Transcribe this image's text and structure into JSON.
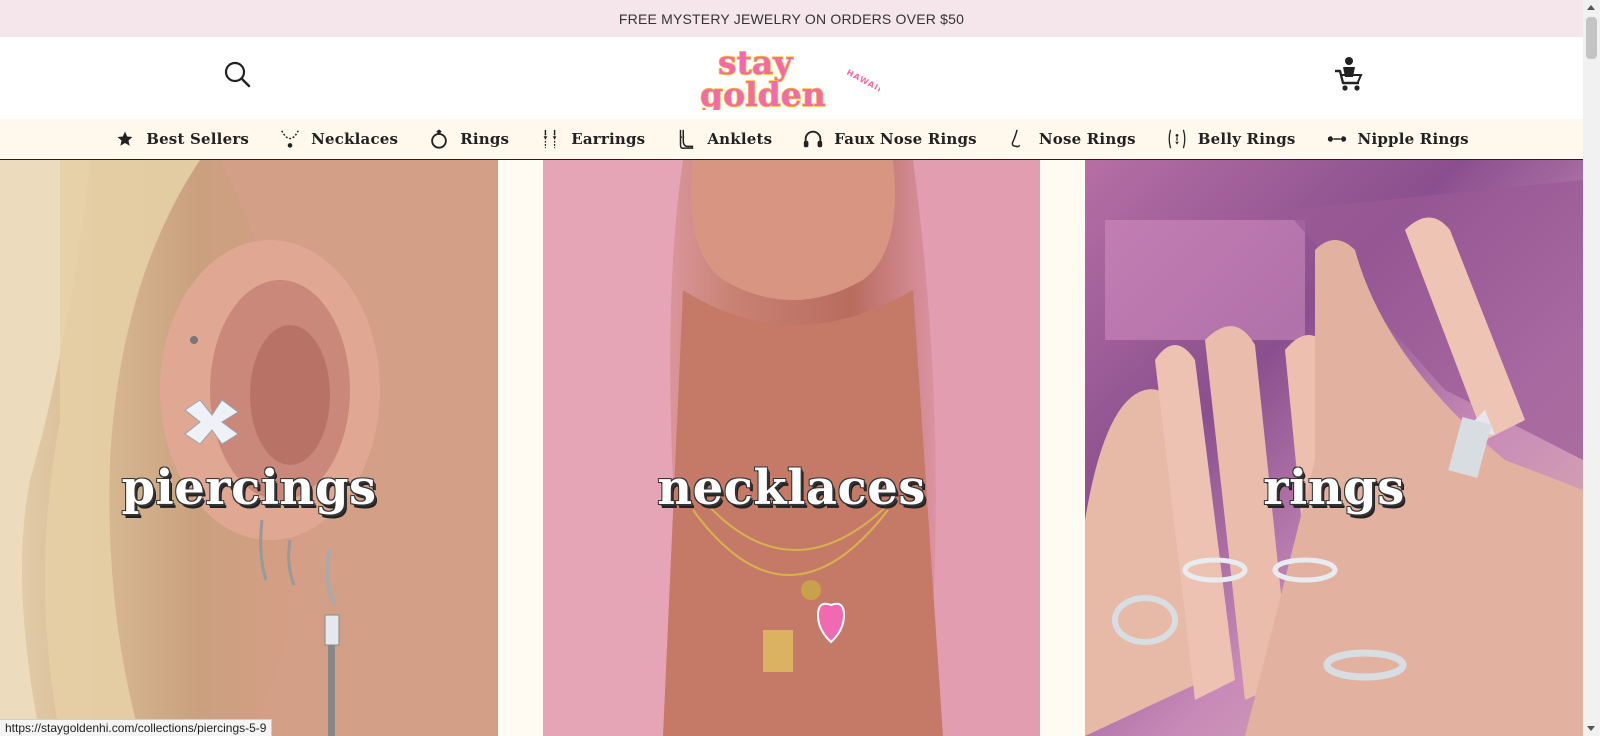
{
  "announcement": {
    "text": "FREE MYSTERY JEWELRY ON ORDERS OVER $50"
  },
  "header": {
    "logo_text": "stay golden",
    "logo_subtext": "HAWAII",
    "search_icon": "search-icon",
    "cart_icon": "cart-icon"
  },
  "nav": {
    "items": [
      {
        "label": "Best Sellers",
        "icon": "star-icon"
      },
      {
        "label": "Necklaces",
        "icon": "necklace-icon"
      },
      {
        "label": "Rings",
        "icon": "ring-icon"
      },
      {
        "label": "Earrings",
        "icon": "earrings-icon"
      },
      {
        "label": "Anklets",
        "icon": "anklet-icon"
      },
      {
        "label": "Faux Nose Rings",
        "icon": "faux-nose-ring-icon"
      },
      {
        "label": "Nose Rings",
        "icon": "nose-icon"
      },
      {
        "label": "Belly Rings",
        "icon": "belly-ring-icon"
      },
      {
        "label": "Nipple Rings",
        "icon": "nipple-ring-icon"
      }
    ]
  },
  "tiles": [
    {
      "label": "piercings"
    },
    {
      "label": "necklaces"
    },
    {
      "label": "rings"
    }
  ],
  "status_bar": {
    "url": "https://staygoldenhi.com/collections/piercings-5-9"
  },
  "colors": {
    "announcement_bg": "#f4e6ea",
    "nav_bg": "#fff8ec",
    "brand_pink": "#f46aa6",
    "brand_gold": "#f7c63d"
  }
}
